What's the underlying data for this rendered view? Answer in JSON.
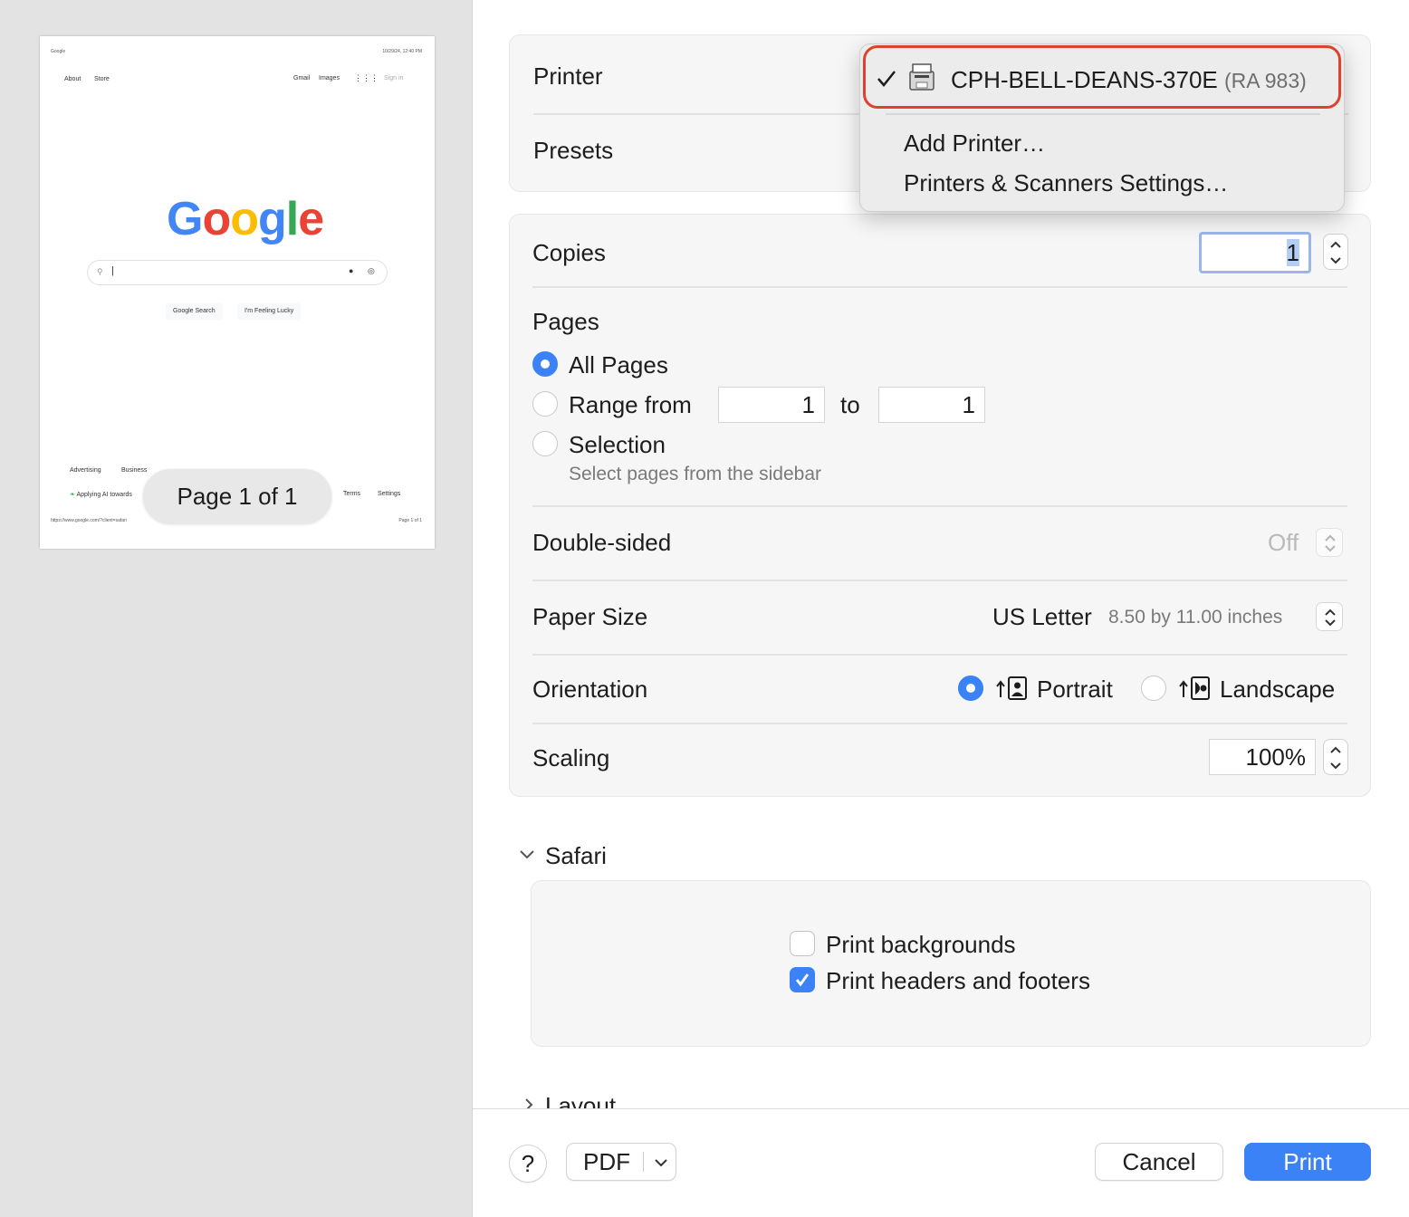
{
  "preview": {
    "thumb": {
      "top_left": "Google",
      "top_right": "10/29/24, 12:40 PM",
      "nav_about": "About",
      "nav_store": "Store",
      "nav_gmail": "Gmail",
      "nav_images": "Images",
      "nav_signin": "Sign in",
      "logo": [
        "G",
        "o",
        "o",
        "g",
        "l",
        "e"
      ],
      "logo_colors": [
        "#4285F4",
        "#EA4335",
        "#FBBC05",
        "#4285F4",
        "#34A853",
        "#EA4335"
      ],
      "btn_search": "Google Search",
      "btn_lucky": "I'm Feeling Lucky",
      "footer_advertising": "Advertising",
      "footer_business": "Business",
      "footer_ai": "Applying AI towards",
      "footer_terms": "Terms",
      "footer_settings": "Settings",
      "footer_url": "https://www.google.com/?client=safari",
      "footer_page": "Page 1 of 1"
    },
    "page_indicator": "Page 1 of 1"
  },
  "printer": {
    "label": "Printer",
    "menu": {
      "selected": "CPH-BELL-DEANS-370E",
      "selected_suffix": "(RA 983)",
      "add": "Add Printer…",
      "settings": "Printers & Scanners Settings…"
    }
  },
  "presets": {
    "label": "Presets"
  },
  "copies": {
    "label": "Copies",
    "value": "1"
  },
  "pages": {
    "label": "Pages",
    "all": "All Pages",
    "range": "Range from",
    "range_from": "1",
    "range_to_label": "to",
    "range_to": "1",
    "selection": "Selection",
    "selection_hint": "Select pages from the sidebar"
  },
  "double_sided": {
    "label": "Double-sided",
    "value": "Off"
  },
  "paper_size": {
    "label": "Paper Size",
    "value": "US Letter",
    "detail": "8.50 by 11.00 inches"
  },
  "orientation": {
    "label": "Orientation",
    "portrait": "Portrait",
    "landscape": "Landscape"
  },
  "scaling": {
    "label": "Scaling",
    "value": "100%"
  },
  "safari": {
    "label": "Safari",
    "print_backgrounds": "Print backgrounds",
    "print_headers": "Print headers and footers"
  },
  "layout": {
    "label": "Layout"
  },
  "bottom": {
    "help": "?",
    "pdf": "PDF",
    "cancel": "Cancel",
    "print": "Print"
  },
  "colors": {
    "accent": "#3b82f6",
    "highlight": "#e0412f"
  }
}
